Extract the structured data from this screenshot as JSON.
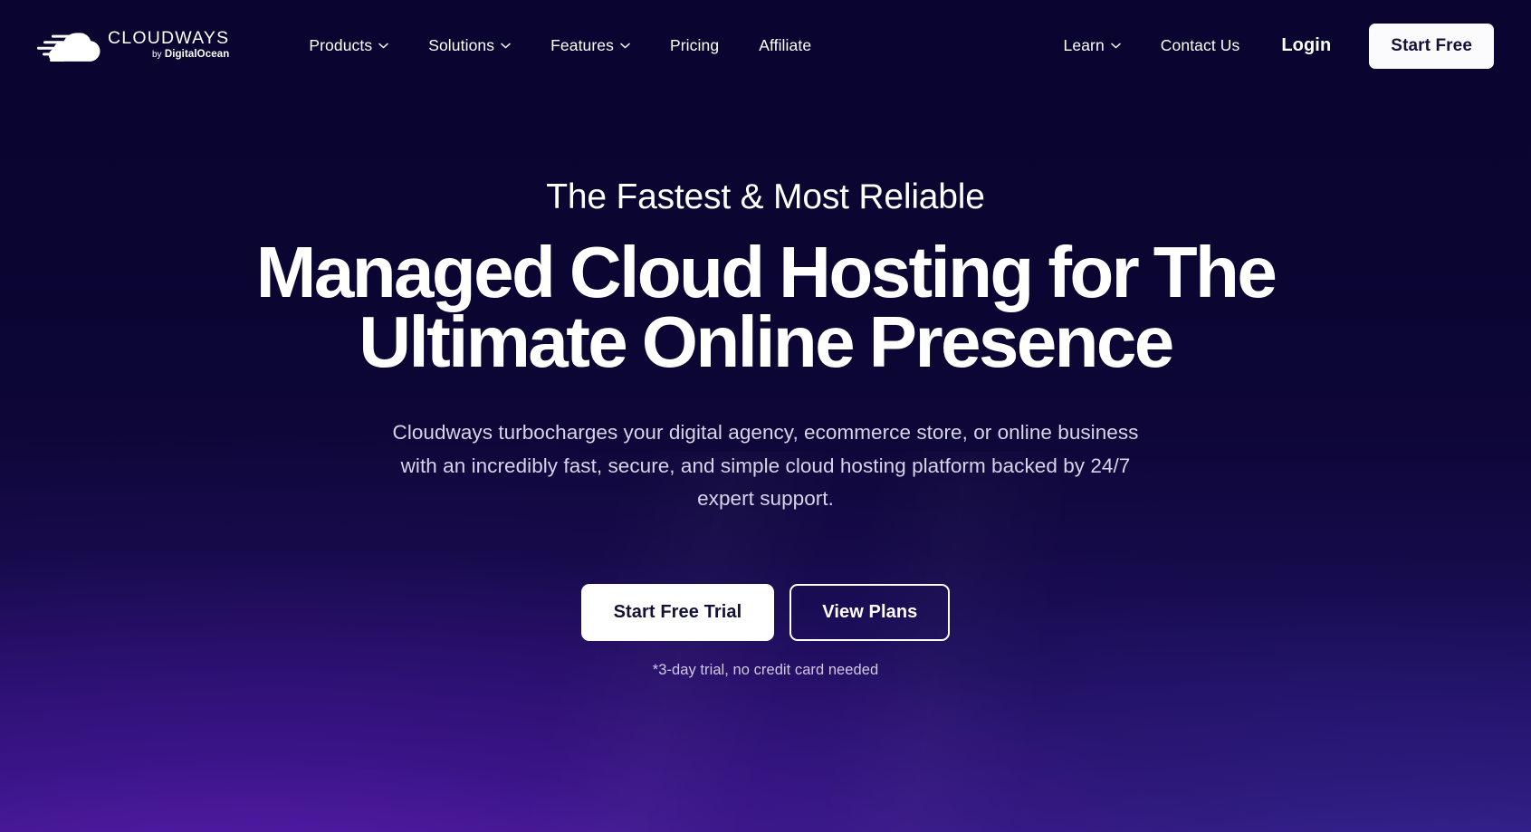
{
  "brand": {
    "name": "CLOUDWAYS",
    "by_prefix": "by",
    "parent": "DigitalOcean",
    "logo_icon": "cloud-speed-icon"
  },
  "nav": {
    "left_items": [
      {
        "label": "Products",
        "has_dropdown": true,
        "icon": "chevron-down-icon"
      },
      {
        "label": "Solutions",
        "has_dropdown": true,
        "icon": "chevron-down-icon"
      },
      {
        "label": "Features",
        "has_dropdown": true,
        "icon": "chevron-down-icon"
      },
      {
        "label": "Pricing",
        "has_dropdown": false,
        "icon": ""
      },
      {
        "label": "Affiliate",
        "has_dropdown": false,
        "icon": ""
      }
    ],
    "right_items": [
      {
        "label": "Learn",
        "has_dropdown": true,
        "icon": "chevron-down-icon"
      },
      {
        "label": "Contact Us",
        "has_dropdown": false,
        "icon": ""
      }
    ],
    "login_label": "Login",
    "start_free_label": "Start Free"
  },
  "hero": {
    "eyebrow": "The Fastest & Most Reliable",
    "headline_line1": "Managed Cloud Hosting for The",
    "headline_line2": "Ultimate Online Presence",
    "subcopy": "Cloudways turbocharges your digital agency, ecommerce store, or online business with an incredibly fast, secure, and simple cloud hosting platform backed by 24/7 expert support.",
    "primary_cta": "Start Free Trial",
    "secondary_cta": "View Plans",
    "disclaimer": "*3-day trial, no credit card needed"
  },
  "colors": {
    "background_top": "#0a0530",
    "background_bottom_left": "#3c1080",
    "background_bottom_right": "#322080",
    "text_on_dark": "#ffffff",
    "button_surface": "#ffffff",
    "button_text": "#131136",
    "muted_text": "#d8d4e8"
  }
}
